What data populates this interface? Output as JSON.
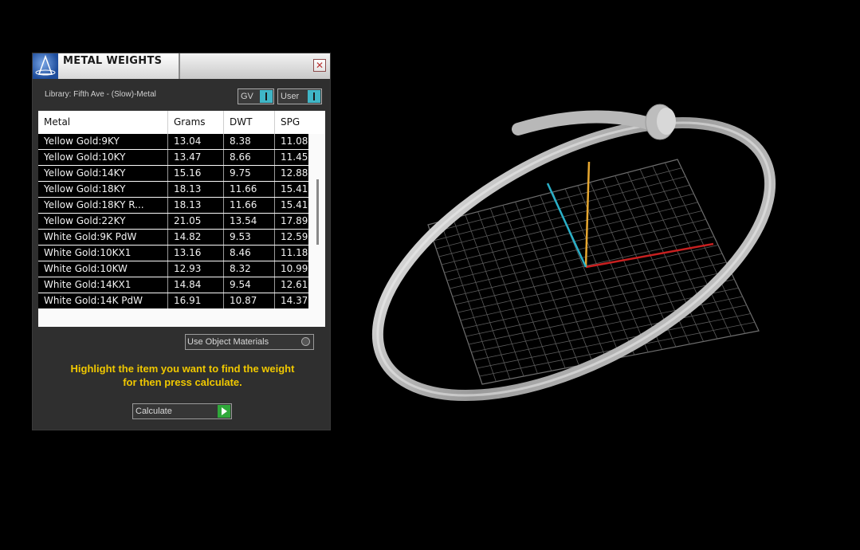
{
  "window": {
    "title": "METAL WEIGHTS",
    "close_glyph": "✕",
    "app_icon": "app-logo-icon"
  },
  "library": {
    "label": "Library: Fifth Ave - (Slow)-Metal"
  },
  "toggles": {
    "gv": "GV",
    "user": "User"
  },
  "table": {
    "headers": [
      "Metal",
      "Grams",
      "DWT",
      "SPG"
    ],
    "rows": [
      [
        "Yellow Gold:9KY",
        "13.04",
        "8.38",
        "11.08"
      ],
      [
        "Yellow Gold:10KY",
        "13.47",
        "8.66",
        "11.45"
      ],
      [
        "Yellow Gold:14KY",
        "15.16",
        "9.75",
        "12.88"
      ],
      [
        "Yellow Gold:18KY",
        "18.13",
        "11.66",
        "15.41"
      ],
      [
        "Yellow Gold:18KY R...",
        "18.13",
        "11.66",
        "15.41"
      ],
      [
        "Yellow Gold:22KY",
        "21.05",
        "13.54",
        "17.89"
      ],
      [
        "White Gold:9K PdW",
        "14.82",
        "9.53",
        "12.59"
      ],
      [
        "White Gold:10KX1",
        "13.16",
        "8.46",
        "11.18"
      ],
      [
        "White Gold:10KW",
        "12.93",
        "8.32",
        "10.99"
      ],
      [
        "White Gold:14KX1",
        "14.84",
        "9.54",
        "12.61"
      ],
      [
        "White Gold:14K PdW",
        "16.91",
        "10.87",
        "14.37"
      ]
    ]
  },
  "options": {
    "use_object_materials": "Use Object Materials"
  },
  "instructions": {
    "line1": "Highlight the item you want to find the weight",
    "line2": "for then press calculate."
  },
  "calculate": {
    "label": "Calculate"
  },
  "colors": {
    "accent_cyan": "#3fb6c7",
    "instruction_yellow": "#f0c800",
    "go_green": "#2fa83a",
    "axis_x": "#c82020",
    "axis_y": "#e8a830",
    "axis_z": "#2ab0c8"
  }
}
